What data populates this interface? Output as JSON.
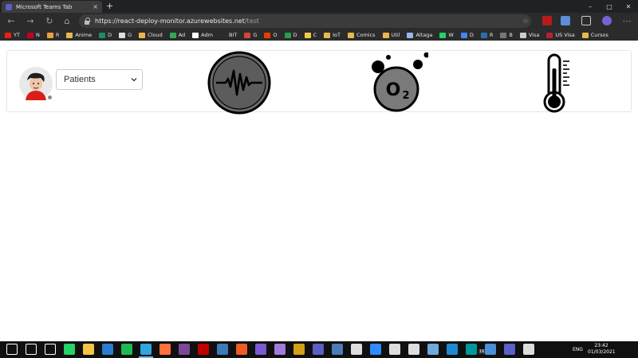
{
  "browser": {
    "tab_title": "Microsoft Teams Tab",
    "tab_close": "×",
    "new_tab": "+",
    "url_host": "https://react-deploy-monitor.azurewebsites.net",
    "url_path": "/test",
    "window_controls": [
      "–",
      "□",
      "✕"
    ],
    "url_icons": [
      "icon-button",
      "collections-icon",
      "adblock-icon",
      "extension-icon",
      "copy-icon",
      "profile-icon",
      "more-icon"
    ],
    "bookmarks": [
      {
        "label": "YT",
        "icon": "youtube-icon",
        "color": "#e62117"
      },
      {
        "label": "N",
        "icon": "netflix-icon",
        "color": "#c4001f"
      },
      {
        "label": "R",
        "icon": "star-icon",
        "color": "#e8a23a"
      },
      {
        "label": "Anime",
        "icon": "folder-icon",
        "color": "#e8b84a"
      },
      {
        "label": "D",
        "icon": "app-icon",
        "color": "#1f8a6c"
      },
      {
        "label": "G",
        "icon": "github-icon",
        "color": "#dddddd"
      },
      {
        "label": "Cloud",
        "icon": "folder-icon",
        "color": "#e8b84a"
      },
      {
        "label": "Ad",
        "icon": "ads-icon",
        "color": "#34a853"
      },
      {
        "label": "Adm",
        "icon": "google-icon",
        "color": "#ffffff"
      },
      {
        "label": "BIT",
        "icon": "bit-icon",
        "color": "#2b2b2b"
      },
      {
        "label": "G",
        "icon": "gmail-icon",
        "color": "#d44638"
      },
      {
        "label": "O",
        "icon": "office-icon",
        "color": "#eb3c00"
      },
      {
        "label": "D",
        "icon": "drive-icon",
        "color": "#2c9a4d"
      },
      {
        "label": "C",
        "icon": "c-icon",
        "color": "#f2c94c"
      },
      {
        "label": "IoT",
        "icon": "folder-icon",
        "color": "#e8b84a"
      },
      {
        "label": "Comics",
        "icon": "folder-icon",
        "color": "#e8b84a"
      },
      {
        "label": "Util",
        "icon": "folder-icon",
        "color": "#e8b84a"
      },
      {
        "label": "Altaga",
        "icon": "altaga-icon",
        "color": "#9ab4e8"
      },
      {
        "label": "W",
        "icon": "whatsapp-icon",
        "color": "#25d366"
      },
      {
        "label": "D",
        "icon": "doc-icon",
        "color": "#4285f4"
      },
      {
        "label": "R",
        "icon": "fr-icon",
        "color": "#2b6cb0"
      },
      {
        "label": "B",
        "icon": "b-icon",
        "color": "#777777"
      },
      {
        "label": "Visa",
        "icon": "visa-icon",
        "color": "#cccccc"
      },
      {
        "label": "US Visa",
        "icon": "flag-icon",
        "color": "#b22234"
      },
      {
        "label": "Cursos",
        "icon": "folder-icon",
        "color": "#e8b84a"
      }
    ]
  },
  "page": {
    "select": {
      "value": "Patients"
    },
    "metrics": [
      {
        "icon": "heart-rate-icon"
      },
      {
        "icon": "oxygen-saturation-icon",
        "label": "O",
        "subscript": "2"
      },
      {
        "icon": "thermometer-icon"
      }
    ],
    "avatar_status_color": "#8a8a8a"
  },
  "taskbar": {
    "apps": [
      {
        "icon": "start-icon",
        "color": "#ffffff"
      },
      {
        "icon": "search-icon",
        "color": "#ffffff"
      },
      {
        "icon": "taskview-icon",
        "color": "#ffffff"
      },
      {
        "icon": "whatsapp-icon",
        "color": "#25d366"
      },
      {
        "icon": "explorer-icon",
        "color": "#f4c542"
      },
      {
        "icon": "mail-icon",
        "color": "#2a7bd1"
      },
      {
        "icon": "spotify-icon",
        "color": "#1db954"
      },
      {
        "icon": "edge-icon",
        "color": "#2fa5e0",
        "active": true
      },
      {
        "icon": "firefox-icon",
        "color": "#ff7139"
      },
      {
        "icon": "tor-icon",
        "color": "#7d4698"
      },
      {
        "icon": "filezilla-icon",
        "color": "#bf0000"
      },
      {
        "icon": "vmware-icon",
        "color": "#3d7bb8"
      },
      {
        "icon": "postman-icon",
        "color": "#ef5b25"
      },
      {
        "icon": "gitkraken-icon",
        "color": "#7a59d1"
      },
      {
        "icon": "github-desktop-icon",
        "color": "#a17bdb"
      },
      {
        "icon": "puzzle-icon",
        "color": "#d4a017"
      },
      {
        "icon": "teams-icon",
        "color": "#5b5fc7"
      },
      {
        "icon": "tool-icon",
        "color": "#4c7bb5"
      },
      {
        "icon": "clock-icon",
        "color": "#dddddd"
      },
      {
        "icon": "zoom-icon",
        "color": "#2d8cff"
      },
      {
        "icon": "terminal-icon",
        "color": "#dddddd"
      },
      {
        "icon": "unity-icon",
        "color": "#dddddd"
      },
      {
        "icon": "network-icon",
        "color": "#6fa8dc"
      },
      {
        "icon": "vscode-icon",
        "color": "#1f8ad2"
      },
      {
        "icon": "arduino-icon",
        "color": "#00979c"
      },
      {
        "icon": "calendar-icon",
        "color": "#4a90d9"
      },
      {
        "icon": "teams2-icon",
        "color": "#5b5fc7"
      },
      {
        "icon": "misc-icon",
        "color": "#dddddd"
      }
    ],
    "badge": "16",
    "language": "ENG",
    "time": "23:42",
    "date": "01/03/2021"
  }
}
